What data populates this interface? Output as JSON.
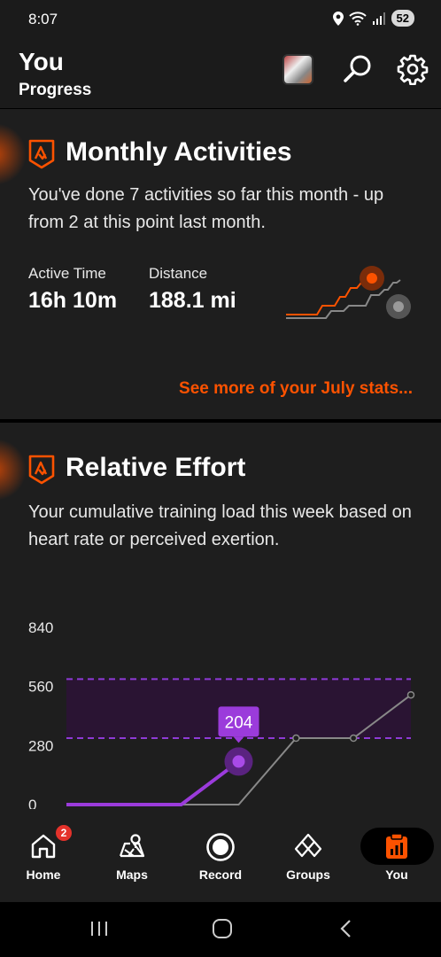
{
  "status": {
    "time": "8:07",
    "battery": "52"
  },
  "header": {
    "title": "You",
    "subtitle": "Progress"
  },
  "monthly": {
    "title": "Monthly Activities",
    "description": "You've done 7 activities so far this month - up from 2 at this point last month.",
    "stats": [
      {
        "label": "Active Time",
        "value": "16h 10m"
      },
      {
        "label": "Distance",
        "value": "188.1 mi"
      }
    ],
    "see_more": "See more of your July stats...",
    "accent_color": "#fc5200"
  },
  "effort": {
    "title": "Relative Effort",
    "description": "Your cumulative training load this week based on heart rate or perceived exertion.",
    "current_label": "204"
  },
  "chart_data": {
    "type": "line",
    "y_ticks": [
      "840",
      "560",
      "280",
      "0"
    ],
    "ylim": [
      0,
      840
    ],
    "x": [
      0,
      1,
      2,
      3,
      4,
      5,
      6
    ],
    "target_range": [
      315,
      595
    ],
    "series": [
      {
        "values": [
          0,
          0,
          0,
          204,
          null,
          null,
          null
        ],
        "color": "#9b3bdb"
      },
      {
        "values": [
          0,
          0,
          0,
          0,
          315,
          315,
          520
        ],
        "color": "#888888"
      }
    ]
  },
  "nav": {
    "items": [
      {
        "label": "Home",
        "badge": "2",
        "icon": "home-icon"
      },
      {
        "label": "Maps",
        "icon": "map-icon"
      },
      {
        "label": "Record",
        "icon": "record-icon"
      },
      {
        "label": "Groups",
        "icon": "groups-icon"
      },
      {
        "label": "You",
        "icon": "you-icon",
        "active": true
      }
    ]
  }
}
